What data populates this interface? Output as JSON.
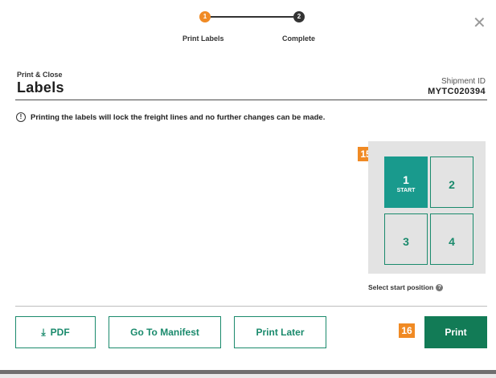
{
  "stepper": {
    "steps": [
      {
        "number": "1",
        "label": "Print Labels",
        "state": "current",
        "color": "#f08a24"
      },
      {
        "number": "2",
        "label": "Complete",
        "state": "upcoming",
        "color": "#333333"
      }
    ],
    "close_icon": "close-icon"
  },
  "header": {
    "subtitle": "Print & Close",
    "title": "Labels",
    "shipment_id_label": "Shipment ID",
    "shipment_id_value": "MYTC020394"
  },
  "warning": {
    "icon": "exclamation-circle-icon",
    "text": "Printing the labels will lock the freight lines and no further changes can be made."
  },
  "annotations": {
    "badge_15": "15",
    "badge_16": "16"
  },
  "label_grid": {
    "positions": [
      {
        "number": "1",
        "sub": "START",
        "selected": true
      },
      {
        "number": "2",
        "selected": false
      },
      {
        "number": "3",
        "selected": false
      },
      {
        "number": "4",
        "selected": false
      }
    ],
    "caption": "Select start position",
    "help_icon": "question-circle-icon"
  },
  "footer": {
    "pdf_label": "PDF",
    "pdf_icon": "download-icon",
    "manifest_label": "Go To Manifest",
    "later_label": "Print Later",
    "print_label": "Print"
  },
  "colors": {
    "accent_orange": "#f08a24",
    "brand_green": "#1a8a6c",
    "selected_teal": "#199a8d",
    "primary_button": "#127b56"
  }
}
